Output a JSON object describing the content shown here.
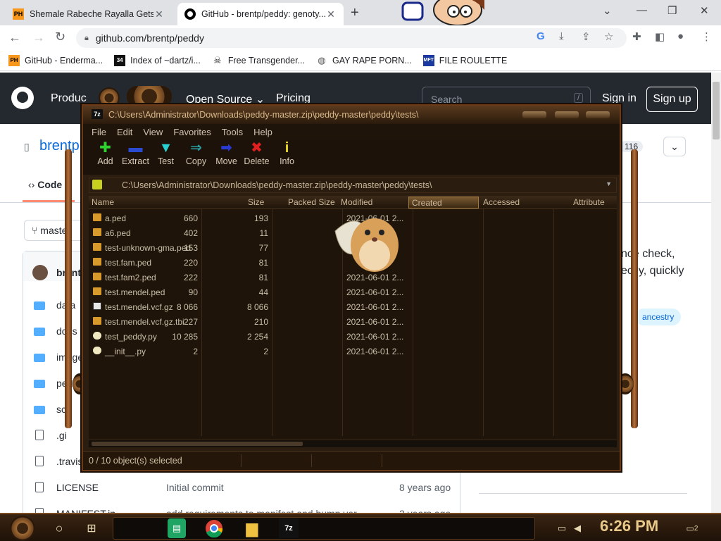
{
  "browser": {
    "tabs": [
      {
        "favicon": "PH",
        "title": "Shemale Rabeche Rayalla Gets..."
      },
      {
        "favicon": "github-icon",
        "title": "GitHub - brentp/peddy: genoty..."
      }
    ],
    "url": "github.com/brentp/peddy",
    "bookmarks": [
      {
        "icon": "PH",
        "label": "GitHub - Enderma..."
      },
      {
        "icon": "34",
        "label": "Index of ~dartz/i..."
      },
      {
        "icon": "skull-icon",
        "label": "Free Transgender..."
      },
      {
        "icon": "globe-icon",
        "label": "GAY RAPE PORN..."
      },
      {
        "icon": "MFT",
        "label": "FILE ROULETTE"
      }
    ]
  },
  "github": {
    "nav": [
      "Produc",
      "Open Source",
      "Pricing"
    ],
    "search_placeholder": "Search",
    "search_key": "/",
    "signin": "Sign in",
    "signup": "Sign up",
    "repo_short": "brentp",
    "star_count": "116",
    "code_tab": "Code",
    "branch": "master",
    "author": "brent",
    "about_text_1": "nce check,",
    "about_text_2": "ectly, quickly",
    "topics": [
      "ancestry"
    ],
    "files": [
      {
        "type": "folder",
        "name": "data"
      },
      {
        "type": "folder",
        "name": "docs"
      },
      {
        "type": "folder",
        "name": "image"
      },
      {
        "type": "folder",
        "name": "ped"
      },
      {
        "type": "folder",
        "name": "sc"
      },
      {
        "type": "file",
        "name": ".gi"
      },
      {
        "type": "file",
        "name": ".travis"
      },
      {
        "type": "file",
        "name": "LICENSE",
        "message": "Initial commit",
        "age": "8 years ago"
      },
      {
        "type": "file",
        "name": "MANIFEST.in",
        "message": "add requirements to manifest and bump ver...",
        "age": "2 years ago"
      }
    ]
  },
  "zip": {
    "title": "C:\\Users\\Administrator\\Downloads\\peddy-master.zip\\peddy-master\\peddy\\tests\\",
    "menu": [
      "File",
      "Edit",
      "View",
      "Favorites",
      "Tools",
      "Help"
    ],
    "tools": [
      {
        "label": "Add",
        "glyph": "+",
        "color": "#2fd12f"
      },
      {
        "label": "Extract",
        "glyph": "—",
        "color": "#2a4ad0"
      },
      {
        "label": "Test",
        "glyph": "✔",
        "color": "#2ad0d0"
      },
      {
        "label": "Copy",
        "glyph": "⇒",
        "color": "#2aa0a0"
      },
      {
        "label": "Move",
        "glyph": "➡",
        "color": "#2a3ad0"
      },
      {
        "label": "Delete",
        "glyph": "✖",
        "color": "#e02020"
      },
      {
        "label": "Info",
        "glyph": "i",
        "color": "#f0e020"
      }
    ],
    "path": "C:\\Users\\Administrator\\Downloads\\peddy-master.zip\\peddy-master\\peddy\\tests\\",
    "columns": [
      "Name",
      "Size",
      "Packed Size",
      "Modified",
      "Created",
      "Accessed",
      "Attribute"
    ],
    "rows": [
      {
        "name": "a.ped",
        "size": "660",
        "packed": "193",
        "modified": "2021-06-01 2...",
        "kind": "file"
      },
      {
        "name": "a6.ped",
        "size": "402",
        "packed": "11",
        "modified": "",
        "kind": "file"
      },
      {
        "name": "test-unknown-gma.ped",
        "size": "153",
        "packed": "77",
        "modified": "",
        "kind": "file"
      },
      {
        "name": "test.fam.ped",
        "size": "220",
        "packed": "81",
        "modified": "",
        "kind": "file"
      },
      {
        "name": "test.fam2.ped",
        "size": "222",
        "packed": "81",
        "modified": "2021-06-01 2...",
        "kind": "file"
      },
      {
        "name": "test.mendel.ped",
        "size": "90",
        "packed": "44",
        "modified": "2021-06-01 2...",
        "kind": "file"
      },
      {
        "name": "test.mendel.vcf.gz",
        "size": "8 066",
        "packed": "8 066",
        "modified": "2021-06-01 2...",
        "kind": "gz"
      },
      {
        "name": "test.mendel.vcf.gz.tbi",
        "size": "227",
        "packed": "210",
        "modified": "2021-06-01 2...",
        "kind": "file"
      },
      {
        "name": "test_peddy.py",
        "size": "10 285",
        "packed": "2 254",
        "modified": "2021-06-01 2...",
        "kind": "py"
      },
      {
        "name": "__init__.py",
        "size": "2",
        "packed": "2",
        "modified": "2021-06-01 2...",
        "kind": "py"
      }
    ],
    "status": "0 / 10 object(s) selected"
  },
  "taskbar": {
    "time": "6:26 PM",
    "notification_count": "2"
  }
}
